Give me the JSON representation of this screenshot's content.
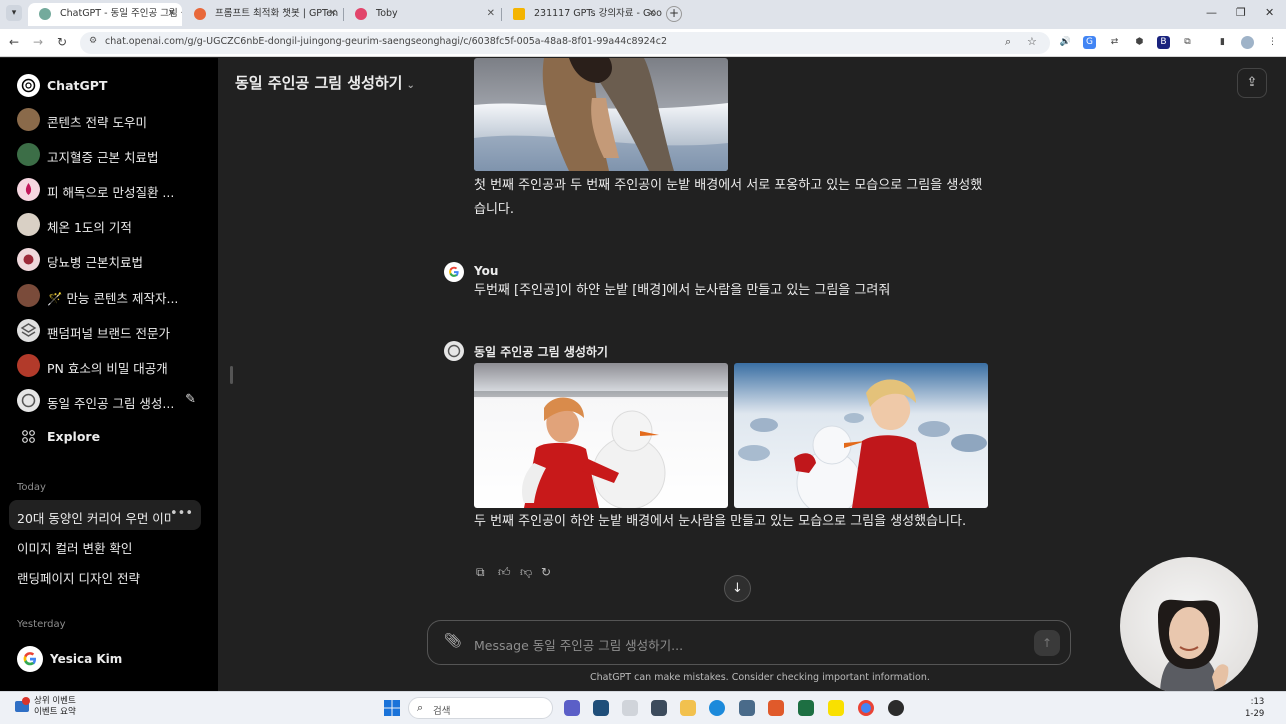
{
  "browser": {
    "tabs": [
      {
        "title": "ChatGPT - 동일 주인공 그림 생",
        "active": true,
        "favicon_color": "#74aa9c"
      },
      {
        "title": "프롬프트 최적화 챗봇 | GPTen",
        "active": false,
        "favicon_color": "#e8683a"
      },
      {
        "title": "Toby",
        "active": false,
        "favicon_color": "#e2456b"
      },
      {
        "title": "231117 GPTs 강의자료 - Goo",
        "active": false,
        "favicon_color": "#f4b400"
      }
    ],
    "url": "chat.openai.com/g/g-UGCZC6nbE-dongil-juingong-geurim-saengseonghagi/c/6038fc5f-005a-48a8-8f01-99a44c8924c2",
    "icons": [
      "chevron-down-icon",
      "close-icon",
      "plus-icon",
      "minimize-icon",
      "maximize-icon",
      "back-icon",
      "forward-icon",
      "reload-icon",
      "zoom-icon",
      "star-icon",
      "extensions-icon"
    ]
  },
  "sidebar": {
    "brand": "ChatGPT",
    "gpts": [
      {
        "label": "콘텐츠 전략 도우미",
        "color": "#8a6a4a"
      },
      {
        "label": "고지혈증 근본 치료법",
        "color": "#3c6e47"
      },
      {
        "label": "피 해독으로 만성질환 ...",
        "color": "#c2185b"
      },
      {
        "label": "체온 1도의 기적",
        "color": "#5a4636"
      },
      {
        "label": "당뇨병 근본치료법",
        "color": "#9c2a3a"
      },
      {
        "label": "🪄 만능 콘텐츠 제작자...",
        "color": "#7a4b3a"
      },
      {
        "label": "팬덤퍼널 브랜드 전문가",
        "color": "#6f6f6f"
      },
      {
        "label": "PN 효소의 비밀 대공개",
        "color": "#b23a2a"
      },
      {
        "label": "동일 주인공 그림 생성...",
        "color": "#9a9a9a"
      }
    ],
    "explore_label": "Explore",
    "today_label": "Today",
    "today": [
      {
        "label": "20대 동양인 커리어 우먼 이미",
        "active": true
      },
      {
        "label": "이미지 컬러 변환 확인",
        "active": false
      },
      {
        "label": "랜딩페이지 디자인 전략",
        "active": false
      }
    ],
    "yesterday_label": "Yesterday",
    "user_name": "Yesica Kim"
  },
  "main": {
    "gpt_title": "동일 주인공 그림 생성하기",
    "messages": [
      {
        "author": "",
        "text": "첫 번째 주인공과 두 번째 주인공이 눈밭 배경에서 서로 포옹하고 있는 모습으로 그림을 생성했습니다."
      },
      {
        "author": "You",
        "text": "두번째 [주인공]이 하얀 눈밭 [배경]에서 눈사람을 만들고 있는 그림을 그려줘"
      },
      {
        "author": "동일 주인공 그림 생성하기",
        "text": "두 번째 주인공이 하얀 눈밭 배경에서 눈사람을 만들고 있는 모습으로 그림을 생성했습니다."
      }
    ],
    "composer_placeholder": "Message 동일 주인공 그림 생성하기...",
    "disclaimer": "ChatGPT can make mistakes. Consider checking important information."
  },
  "taskbar": {
    "news_title": "상위 이벤트",
    "news_sub": "이벤트 요약",
    "search_placeholder": "검색",
    "clock_time": ":13",
    "clock_date": "1-29"
  }
}
